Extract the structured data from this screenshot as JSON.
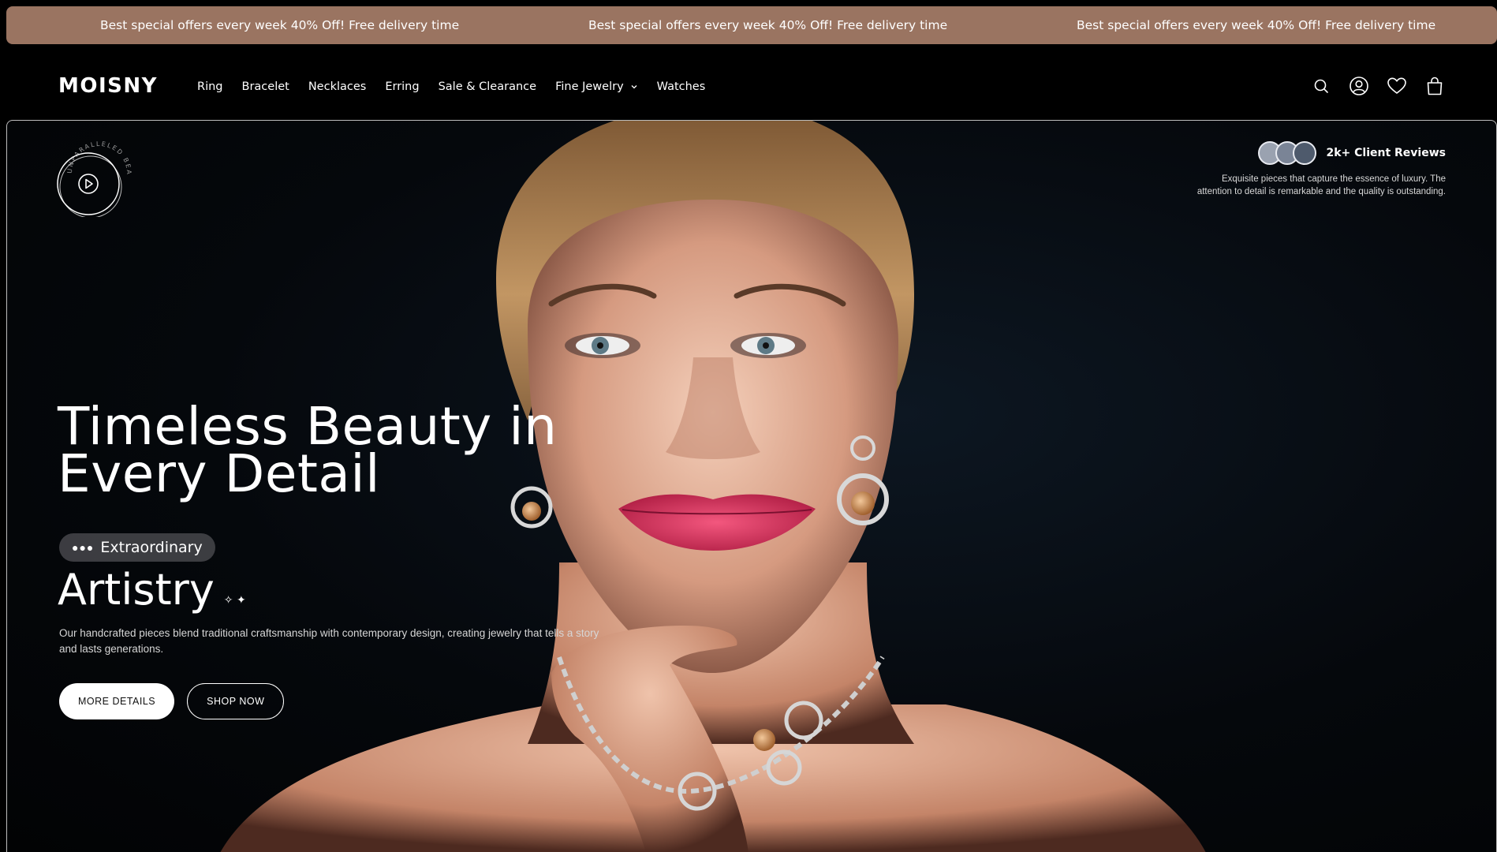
{
  "promo": {
    "items": [
      "Best special offers every week 40% Off! Free delivery time",
      "Best special offers every week 40% Off! Free delivery time",
      "Best special offers every week 40% Off! Free delivery time"
    ],
    "background": "#9a7461"
  },
  "header": {
    "logo": "MOISNY",
    "nav": [
      {
        "label": "Ring"
      },
      {
        "label": "Bracelet"
      },
      {
        "label": "Necklaces"
      },
      {
        "label": "Erring"
      },
      {
        "label": "Sale & Clearance"
      },
      {
        "label": "Fine Jewelry",
        "has_dropdown": true
      },
      {
        "label": "Watches"
      }
    ],
    "icons": [
      "search-icon",
      "account-icon",
      "heart-icon",
      "shopping-bag-icon"
    ]
  },
  "hero": {
    "badge_text": "UNPARALLELED BEAUTY",
    "badge_icon": "play-icon",
    "reviews": {
      "count_label": "2k+ Client Reviews",
      "text": "Exquisite pieces that capture the essence of luxury. The attention to detail is remarkable and the quality is outstanding."
    },
    "title": "Timeless Beauty in Every Detail",
    "pill_label": "Extraordinary",
    "subtitle": "Artistry",
    "description": "Our handcrafted pieces blend traditional craftsmanship with contemporary design, creating jewelry that tells a story and lasts generations.",
    "buttons": {
      "more_details": "MORE DETAILS",
      "shop_now": "SHOP NOW"
    }
  }
}
